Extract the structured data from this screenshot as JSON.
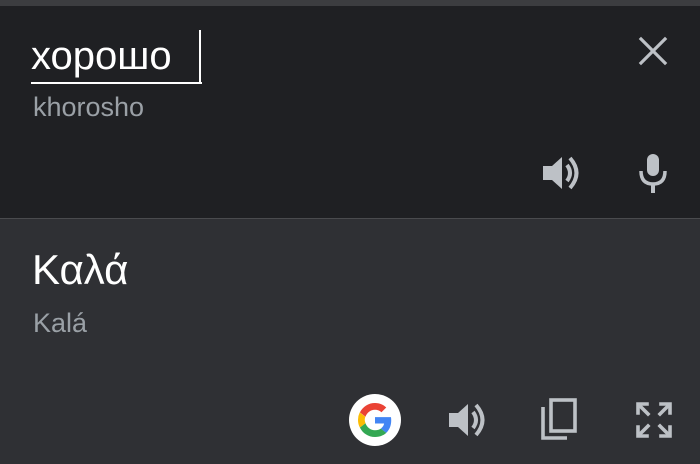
{
  "source": {
    "text": "хорошо",
    "transliteration": "khorosho"
  },
  "target": {
    "text": "Καλά",
    "transliteration": "Kalá"
  },
  "icons": {
    "clear": "close-icon",
    "source_speaker": "speaker-icon",
    "microphone": "microphone-icon",
    "google": "google-icon",
    "target_speaker": "speaker-icon",
    "copy": "copy-icon",
    "fullscreen": "fullscreen-icon"
  },
  "colors": {
    "source_background": "#1f2023",
    "target_background": "#2f3034",
    "text_primary": "#ffffff",
    "text_secondary": "#9aa0a6",
    "icon": "#bdc1c6"
  }
}
